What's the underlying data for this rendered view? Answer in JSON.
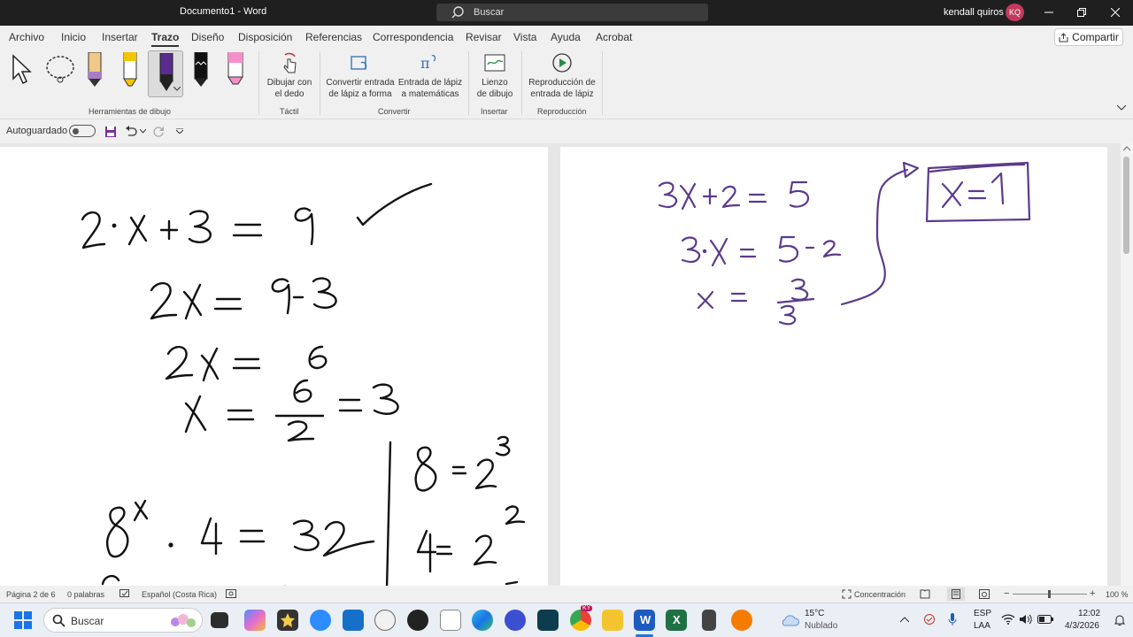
{
  "window": {
    "document_title": "Documento1  -  Word",
    "search_placeholder": "Buscar",
    "user_name": "kendall quiros",
    "user_initials": "KQ"
  },
  "menu": {
    "items": [
      "Archivo",
      "Inicio",
      "Insertar",
      "Trazo",
      "Diseño",
      "Disposición",
      "Referencias",
      "Correspondencia",
      "Revisar",
      "Vista",
      "Ayuda",
      "Acrobat"
    ],
    "active": "Trazo",
    "share_label": "Compartir"
  },
  "ribbon": {
    "groups": {
      "drawing_tools": "Herramientas de dibujo",
      "touch": "Táctil",
      "convert": "Convertir",
      "insert": "Insertar",
      "replay": "Reproducción"
    },
    "buttons": {
      "draw_with_finger": [
        "Dibujar con",
        "el dedo"
      ],
      "ink_to_shape": [
        "Convertir entrada",
        "de lápiz a forma"
      ],
      "ink_to_math": [
        "Entrada de lápiz",
        "a matemáticas"
      ],
      "drawing_canvas": [
        "Lienzo",
        "de dibujo"
      ],
      "ink_replay": [
        "Reproducción de",
        "entrada de lápiz"
      ]
    },
    "pens": [
      {
        "name": "pencil-tan",
        "color": "#a77ec4"
      },
      {
        "name": "highlighter-yellow",
        "color": "#f5c400"
      },
      {
        "name": "pen-purple",
        "color": "#5b2c8f"
      },
      {
        "name": "pen-black",
        "color": "#111111"
      },
      {
        "name": "highlighter-pink",
        "color": "#f58fc8"
      }
    ]
  },
  "qat": {
    "autosave_label": "Autoguardado"
  },
  "ink": {
    "left_color": "#111111",
    "right_color": "#5b3a8c"
  },
  "status": {
    "page": "Página 2 de 6",
    "words": "0 palabras",
    "language": "Español (Costa Rica)",
    "focus": "Concentración",
    "zoom": "100 %"
  },
  "taskbar": {
    "search_label": "Buscar",
    "weather_temp": "15°C",
    "weather_desc": "Nublado",
    "lang_top": "ESP",
    "lang_bottom": "LAA",
    "time": "12:02",
    "date": "4/3/2026",
    "chrome_badge": "KY"
  }
}
